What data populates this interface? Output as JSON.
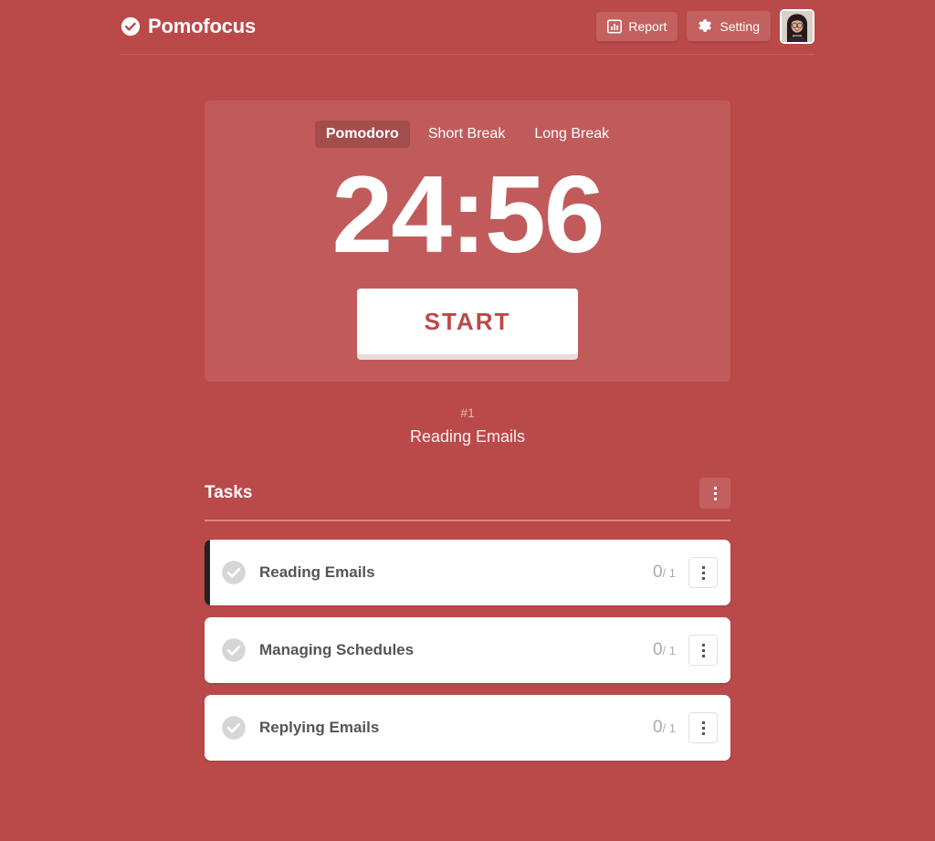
{
  "app": {
    "brand_name": "Pomofocus",
    "background_color": "#ba4949",
    "accent_color": "#ba4949"
  },
  "header": {
    "report_label": "Report",
    "setting_label": "Setting",
    "report_icon": "bar-chart-icon",
    "setting_icon": "gear-icon",
    "avatar_alt": "user-avatar"
  },
  "timer": {
    "tabs": [
      {
        "label": "Pomodoro",
        "active": true
      },
      {
        "label": "Short Break",
        "active": false
      },
      {
        "label": "Long Break",
        "active": false
      }
    ],
    "display": "24:56",
    "start_label": "START"
  },
  "current_task": {
    "index": "#1",
    "name": "Reading Emails"
  },
  "tasks": {
    "title": "Tasks",
    "menu_icon": "vertical-dots-icon",
    "items": [
      {
        "name": "Reading Emails",
        "done": "0",
        "total": "/ 1",
        "active": true
      },
      {
        "name": "Managing Schedules",
        "done": "0",
        "total": "/ 1",
        "active": false
      },
      {
        "name": "Replying Emails",
        "done": "0",
        "total": "/ 1",
        "active": false
      }
    ]
  }
}
